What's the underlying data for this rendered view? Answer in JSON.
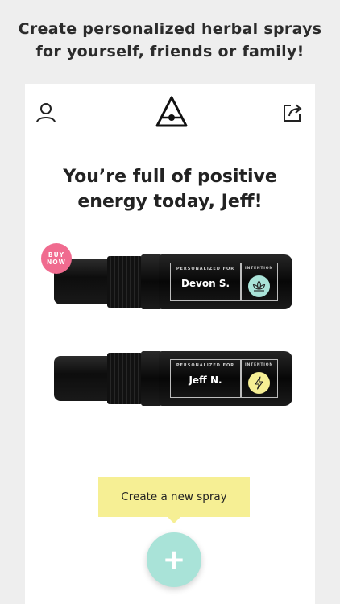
{
  "promo": {
    "line1": "Create personalized herbal sprays",
    "line2": "for yourself, friends or family!"
  },
  "header": {
    "icons": [
      "user-icon",
      "triangle-eye-logo",
      "share-icon"
    ]
  },
  "headline": {
    "line1": "You’re full of positive",
    "line2": "energy today, Jeff!"
  },
  "buy_now": {
    "line1": "BUY",
    "line2": "NOW",
    "color": "#f06b8f"
  },
  "sprays": [
    {
      "personalized_for_label": "PERSONALIZED FOR",
      "intention_label": "INTENTION",
      "name": "Devon S.",
      "intention_icon": "lotus-icon",
      "intention_color": "#a9e3d8"
    },
    {
      "personalized_for_label": "PERSONALIZED FOR",
      "intention_label": "INTENTION",
      "name": "Jeff N.",
      "intention_icon": "lightning-icon",
      "intention_color": "#f6ef94"
    }
  ],
  "tooltip": {
    "text": "Create a new spray",
    "color": "#f6ef94"
  },
  "fab": {
    "label": "+",
    "color": "#a9e3d8"
  }
}
